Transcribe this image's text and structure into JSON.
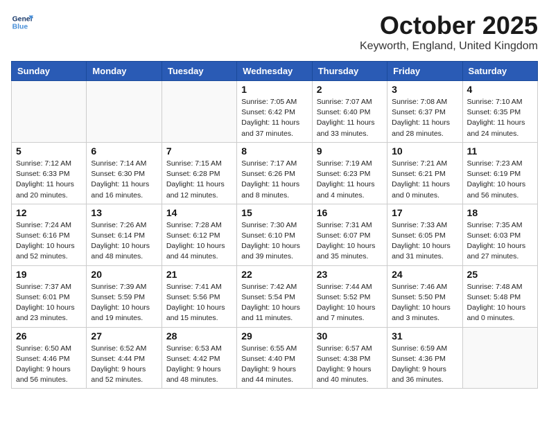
{
  "header": {
    "logo_line1": "General",
    "logo_line2": "Blue",
    "month": "October 2025",
    "location": "Keyworth, England, United Kingdom"
  },
  "weekdays": [
    "Sunday",
    "Monday",
    "Tuesday",
    "Wednesday",
    "Thursday",
    "Friday",
    "Saturday"
  ],
  "weeks": [
    [
      {
        "day": "",
        "info": ""
      },
      {
        "day": "",
        "info": ""
      },
      {
        "day": "",
        "info": ""
      },
      {
        "day": "1",
        "info": "Sunrise: 7:05 AM\nSunset: 6:42 PM\nDaylight: 11 hours\nand 37 minutes."
      },
      {
        "day": "2",
        "info": "Sunrise: 7:07 AM\nSunset: 6:40 PM\nDaylight: 11 hours\nand 33 minutes."
      },
      {
        "day": "3",
        "info": "Sunrise: 7:08 AM\nSunset: 6:37 PM\nDaylight: 11 hours\nand 28 minutes."
      },
      {
        "day": "4",
        "info": "Sunrise: 7:10 AM\nSunset: 6:35 PM\nDaylight: 11 hours\nand 24 minutes."
      }
    ],
    [
      {
        "day": "5",
        "info": "Sunrise: 7:12 AM\nSunset: 6:33 PM\nDaylight: 11 hours\nand 20 minutes."
      },
      {
        "day": "6",
        "info": "Sunrise: 7:14 AM\nSunset: 6:30 PM\nDaylight: 11 hours\nand 16 minutes."
      },
      {
        "day": "7",
        "info": "Sunrise: 7:15 AM\nSunset: 6:28 PM\nDaylight: 11 hours\nand 12 minutes."
      },
      {
        "day": "8",
        "info": "Sunrise: 7:17 AM\nSunset: 6:26 PM\nDaylight: 11 hours\nand 8 minutes."
      },
      {
        "day": "9",
        "info": "Sunrise: 7:19 AM\nSunset: 6:23 PM\nDaylight: 11 hours\nand 4 minutes."
      },
      {
        "day": "10",
        "info": "Sunrise: 7:21 AM\nSunset: 6:21 PM\nDaylight: 11 hours\nand 0 minutes."
      },
      {
        "day": "11",
        "info": "Sunrise: 7:23 AM\nSunset: 6:19 PM\nDaylight: 10 hours\nand 56 minutes."
      }
    ],
    [
      {
        "day": "12",
        "info": "Sunrise: 7:24 AM\nSunset: 6:16 PM\nDaylight: 10 hours\nand 52 minutes."
      },
      {
        "day": "13",
        "info": "Sunrise: 7:26 AM\nSunset: 6:14 PM\nDaylight: 10 hours\nand 48 minutes."
      },
      {
        "day": "14",
        "info": "Sunrise: 7:28 AM\nSunset: 6:12 PM\nDaylight: 10 hours\nand 44 minutes."
      },
      {
        "day": "15",
        "info": "Sunrise: 7:30 AM\nSunset: 6:10 PM\nDaylight: 10 hours\nand 39 minutes."
      },
      {
        "day": "16",
        "info": "Sunrise: 7:31 AM\nSunset: 6:07 PM\nDaylight: 10 hours\nand 35 minutes."
      },
      {
        "day": "17",
        "info": "Sunrise: 7:33 AM\nSunset: 6:05 PM\nDaylight: 10 hours\nand 31 minutes."
      },
      {
        "day": "18",
        "info": "Sunrise: 7:35 AM\nSunset: 6:03 PM\nDaylight: 10 hours\nand 27 minutes."
      }
    ],
    [
      {
        "day": "19",
        "info": "Sunrise: 7:37 AM\nSunset: 6:01 PM\nDaylight: 10 hours\nand 23 minutes."
      },
      {
        "day": "20",
        "info": "Sunrise: 7:39 AM\nSunset: 5:59 PM\nDaylight: 10 hours\nand 19 minutes."
      },
      {
        "day": "21",
        "info": "Sunrise: 7:41 AM\nSunset: 5:56 PM\nDaylight: 10 hours\nand 15 minutes."
      },
      {
        "day": "22",
        "info": "Sunrise: 7:42 AM\nSunset: 5:54 PM\nDaylight: 10 hours\nand 11 minutes."
      },
      {
        "day": "23",
        "info": "Sunrise: 7:44 AM\nSunset: 5:52 PM\nDaylight: 10 hours\nand 7 minutes."
      },
      {
        "day": "24",
        "info": "Sunrise: 7:46 AM\nSunset: 5:50 PM\nDaylight: 10 hours\nand 3 minutes."
      },
      {
        "day": "25",
        "info": "Sunrise: 7:48 AM\nSunset: 5:48 PM\nDaylight: 10 hours\nand 0 minutes."
      }
    ],
    [
      {
        "day": "26",
        "info": "Sunrise: 6:50 AM\nSunset: 4:46 PM\nDaylight: 9 hours\nand 56 minutes."
      },
      {
        "day": "27",
        "info": "Sunrise: 6:52 AM\nSunset: 4:44 PM\nDaylight: 9 hours\nand 52 minutes."
      },
      {
        "day": "28",
        "info": "Sunrise: 6:53 AM\nSunset: 4:42 PM\nDaylight: 9 hours\nand 48 minutes."
      },
      {
        "day": "29",
        "info": "Sunrise: 6:55 AM\nSunset: 4:40 PM\nDaylight: 9 hours\nand 44 minutes."
      },
      {
        "day": "30",
        "info": "Sunrise: 6:57 AM\nSunset: 4:38 PM\nDaylight: 9 hours\nand 40 minutes."
      },
      {
        "day": "31",
        "info": "Sunrise: 6:59 AM\nSunset: 4:36 PM\nDaylight: 9 hours\nand 36 minutes."
      },
      {
        "day": "",
        "info": ""
      }
    ]
  ]
}
